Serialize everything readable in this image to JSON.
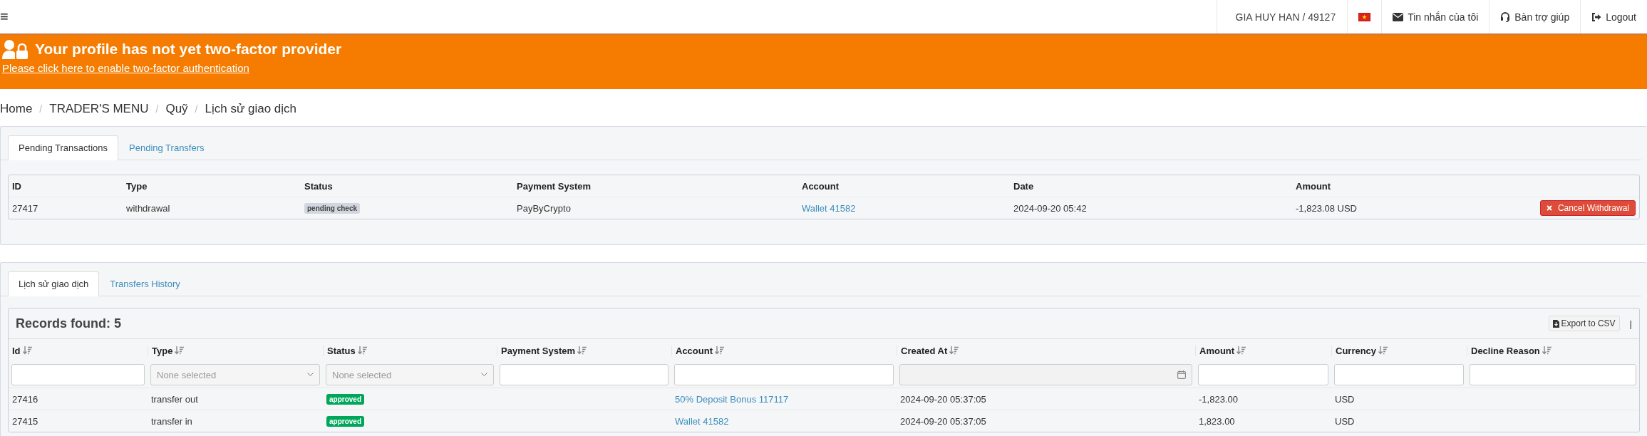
{
  "top_bar": {
    "menu_icon": "≡",
    "user": "GIA HUY HAN / 49127",
    "links": [
      {
        "kind": "envelope",
        "label": "Tin nhắn của tôi"
      },
      {
        "kind": "headset",
        "label": "Bàn trợ giúp"
      },
      {
        "kind": "logout",
        "label": "Logout"
      }
    ]
  },
  "banner": {
    "title": "Your profile has not yet two-factor provider",
    "link": "Please click here to enable two-factor authentication"
  },
  "breadcrumb": {
    "separator": "/",
    "items": [
      "Home",
      "TRADER'S MENU",
      "Quỹ",
      "Lịch sử giao dịch"
    ]
  },
  "pending": {
    "tabs": [
      {
        "label": "Pending Transactions",
        "selected": true
      },
      {
        "label": "Pending Transfers",
        "selected": false
      }
    ],
    "columns": [
      "ID",
      "Type",
      "Status",
      "Payment System",
      "Account",
      "Date",
      "Amount"
    ],
    "rows": [
      {
        "id": "27417",
        "type": "withdrawal",
        "status": {
          "label": "pending check",
          "color": "#d2d6de"
        },
        "payment_system": "PayByCrypto",
        "account": "Wallet 41582",
        "date": "2024-09-20 05:42",
        "amount": "-1,823.08 USD",
        "action": "Cancel Withdrawal"
      }
    ]
  },
  "history": {
    "tabs": [
      {
        "label": "Lịch sử giao dịch",
        "selected": true
      },
      {
        "label": "Transfers History",
        "selected": false
      }
    ],
    "records_found": "Records found: 5",
    "export": "Export to CSV",
    "separator": "|",
    "columns": [
      {
        "label": "Id",
        "kind": "text"
      },
      {
        "label": "Type",
        "kind": "select",
        "placeholder": "None selected"
      },
      {
        "label": "Status",
        "kind": "select",
        "placeholder": "None selected"
      },
      {
        "label": "Payment System",
        "kind": "text"
      },
      {
        "label": "Account",
        "kind": "text"
      },
      {
        "label": "Created At",
        "kind": "date"
      },
      {
        "label": "Amount",
        "kind": "text"
      },
      {
        "label": "Currency",
        "kind": "text"
      },
      {
        "label": "Decline Reason",
        "kind": "text"
      }
    ],
    "rows": [
      {
        "id": "27416",
        "type": "transfer out",
        "status": {
          "label": "approved",
          "color": "#00a65a"
        },
        "account": "50% Deposit Bonus 117117",
        "created_at": "2024-09-20 05:37:05",
        "amount": "-1,823.00",
        "currency": "USD"
      },
      {
        "id": "27415",
        "type": "transfer in",
        "status": {
          "label": "approved",
          "color": "#00a65a"
        },
        "account": "Wallet 41582",
        "created_at": "2024-09-20 05:37:05",
        "amount": "1,823.00",
        "currency": "USD"
      }
    ]
  }
}
